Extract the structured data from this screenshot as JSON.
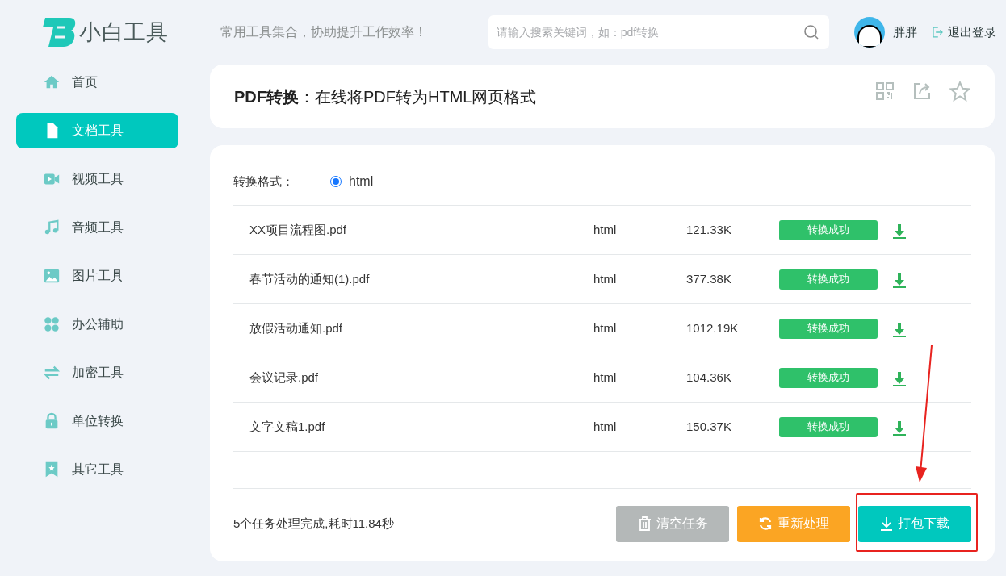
{
  "header": {
    "logo_text": "小白工具",
    "tagline": "常用工具集合，协助提升工作效率！",
    "search": {
      "placeholder": "请输入搜索关键词，如：pdf转换"
    },
    "user": {
      "name": "胖胖"
    },
    "logout": "退出登录"
  },
  "sidebar": {
    "items": [
      {
        "label": "首页",
        "selected": false
      },
      {
        "label": "文档工具",
        "selected": true
      },
      {
        "label": "视频工具",
        "selected": false
      },
      {
        "label": "音频工具",
        "selected": false
      },
      {
        "label": "图片工具",
        "selected": false
      },
      {
        "label": "办公辅助",
        "selected": false
      },
      {
        "label": "加密工具",
        "selected": false
      },
      {
        "label": "单位转换",
        "selected": false
      },
      {
        "label": "其它工具",
        "selected": false
      }
    ]
  },
  "page_title": "**PDF转换**：在线将PDF转为HTML网页格式",
  "format": {
    "label": "转换格式：",
    "options": [
      {
        "label": "html",
        "selected": true
      }
    ]
  },
  "table": {
    "rows": [
      {
        "name": "XX项目流程图.pdf",
        "format": "html",
        "size": "121.33K",
        "status": "转换成功"
      },
      {
        "name": "春节活动的通知(1).pdf",
        "format": "html",
        "size": "377.38K",
        "status": "转换成功"
      },
      {
        "name": "放假活动通知.pdf",
        "format": "html",
        "size": "1012.19K",
        "status": "转换成功"
      },
      {
        "name": "会议记录.pdf",
        "format": "html",
        "size": "104.36K",
        "status": "转换成功"
      },
      {
        "name": "文字文稿1.pdf",
        "format": "html",
        "size": "150.37K",
        "status": "转换成功"
      }
    ]
  },
  "summary": "5个任务处理完成,耗时11.84秒",
  "buttons": [
    {
      "kind": "clear",
      "label": "清空任务"
    },
    {
      "kind": "redo",
      "label": "重新处理"
    },
    {
      "kind": "download",
      "label": "打包下载"
    }
  ]
}
